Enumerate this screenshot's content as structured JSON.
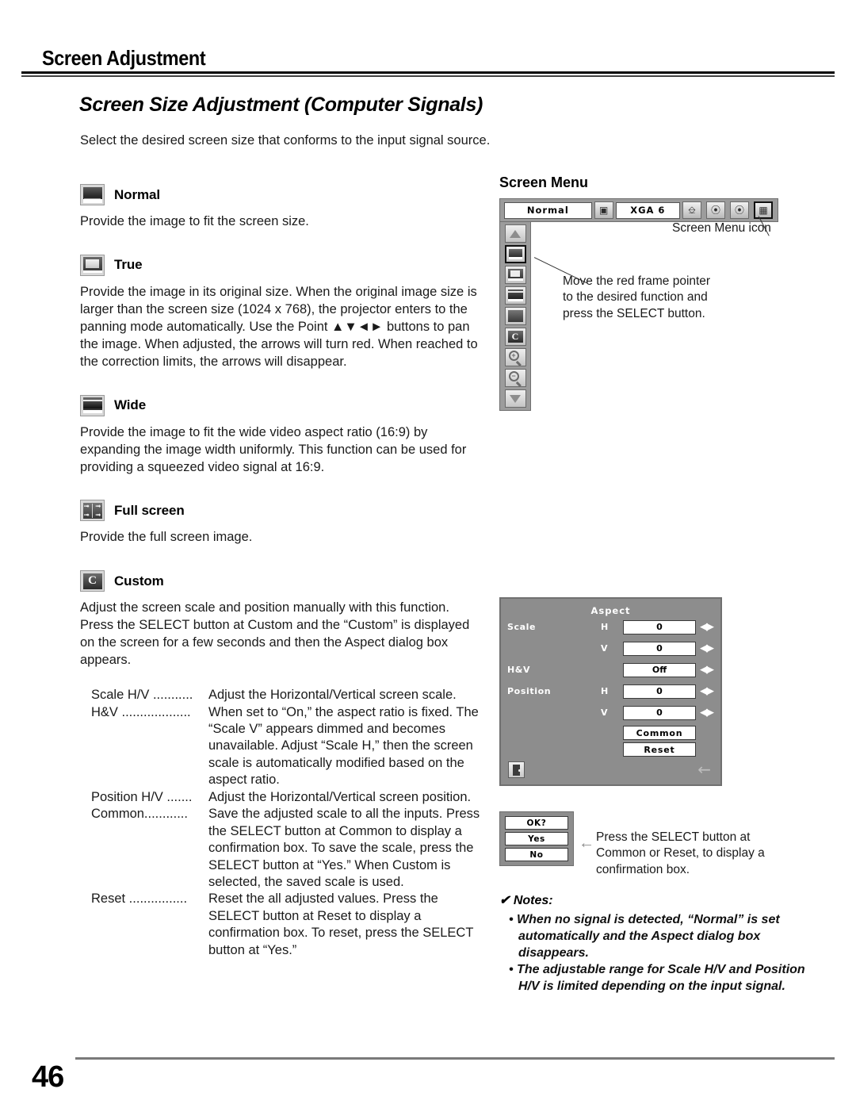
{
  "header": {
    "title": "Screen Adjustment"
  },
  "section": {
    "heading": "Screen Size Adjustment (Computer Signals)",
    "lead": "Select the desired screen size that conforms to the input signal source."
  },
  "items": [
    {
      "icon": "screen-normal-icon",
      "label": "Normal",
      "body": "Provide the image to fit the screen size."
    },
    {
      "icon": "screen-true-icon",
      "label": "True",
      "body": "Provide the image in its original size. When the original image size is larger than the screen size (1024 x 768), the projector enters to the panning mode automatically. Use the Point ▲▼◄► buttons to pan the image. When adjusted, the arrows will turn red. When reached to the correction limits, the arrows will disappear."
    },
    {
      "icon": "screen-wide-icon",
      "label": "Wide",
      "body": "Provide the image to fit the wide video aspect ratio (16:9) by expanding the image width uniformly. This function can be used for providing a squeezed video signal at 16:9."
    },
    {
      "icon": "screen-full-icon",
      "label": "Full screen",
      "body": "Provide the full screen image."
    },
    {
      "icon": "screen-custom-icon",
      "label": "Custom",
      "body": "Adjust the screen scale and position manually with this function.\nPress the SELECT button at Custom and the “Custom” is displayed on the screen for a few seconds and then the Aspect dialog box appears."
    }
  ],
  "definitions": [
    {
      "term": "Scale H/V ...........",
      "desc": "Adjust the Horizontal/Vertical screen scale."
    },
    {
      "term": "H&V ...................",
      "desc": "When set to “On,” the aspect ratio is fixed. The “Scale V” appears dimmed and becomes unavailable. Adjust “Scale H,” then the screen scale is automatically modified based on the aspect ratio."
    },
    {
      "term": "Position H/V .......",
      "desc": "Adjust the Horizontal/Vertical screen position."
    },
    {
      "term": "Common............",
      "desc": "Save the adjusted scale to all the inputs. Press the SELECT button at Common to display a confirmation box. To save the scale, press the SELECT button at “Yes.” When Custom is selected, the saved scale is used."
    },
    {
      "term": "Reset ................",
      "desc": "Reset the all adjusted values. Press the SELECT button at Reset to display a confirmation box. To reset, press the SELECT button at “Yes.”"
    }
  ],
  "screen_menu": {
    "title": "Screen Menu",
    "bar": {
      "mode_value": "Normal",
      "signal_value": "XGA 6",
      "icons": [
        "input-source-icon",
        "computer-icon",
        "color-adjust-icon",
        "image-select-icon",
        "screen-menu-icon"
      ]
    },
    "side_icons": [
      {
        "name": "scroll-up-icon",
        "label": "▲"
      },
      {
        "name": "normal-icon",
        "label": ""
      },
      {
        "name": "true-icon",
        "label": ""
      },
      {
        "name": "wide-icon",
        "label": ""
      },
      {
        "name": "full-screen-icon",
        "label": ""
      },
      {
        "name": "custom-icon",
        "label": "C"
      },
      {
        "name": "zoom-in-icon",
        "label": "+"
      },
      {
        "name": "zoom-out-icon",
        "label": "−"
      },
      {
        "name": "scroll-down-icon",
        "label": "▼"
      }
    ],
    "callout_icon": "Screen Menu icon",
    "callout_pointer": "Move the red frame pointer\nto the desired function and\npress the SELECT button."
  },
  "aspect_dialog": {
    "title": "Aspect",
    "rows": [
      {
        "name": "Scale",
        "axis": "H",
        "value": "0"
      },
      {
        "name": "",
        "axis": "V",
        "value": "0"
      },
      {
        "name": "H&V",
        "axis": "",
        "value": "Off"
      },
      {
        "name": "Position",
        "axis": "H",
        "value": "0"
      },
      {
        "name": "",
        "axis": "V",
        "value": "0"
      }
    ],
    "buttons": [
      "Common",
      "Reset"
    ],
    "exit_icon": "exit-door-icon",
    "back_arrow": "←"
  },
  "confirm_dialog": {
    "prompt": "OK?",
    "yes": "Yes",
    "no": "No",
    "arrow": "←",
    "caption": "Press the SELECT button at Common or Reset, to display a confirmation box."
  },
  "notes": {
    "heading": "✔ Notes:",
    "items": [
      "When no signal is detected, “Normal” is set automatically and the Aspect dialog box disappears.",
      "The adjustable range for Scale H/V and Position H/V is limited depending on the input signal."
    ]
  },
  "footer": {
    "page_number": "46"
  }
}
